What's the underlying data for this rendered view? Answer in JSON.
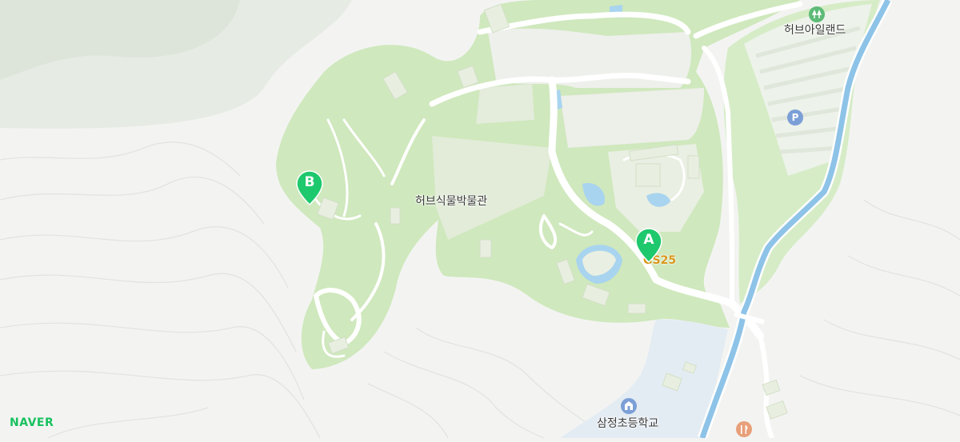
{
  "brand": "NAVER",
  "labels": {
    "museum": "허브식물박물관",
    "herb_island": "허브아일랜드",
    "school": "삼정초등학교"
  },
  "markers": {
    "a": "A",
    "b": "B"
  },
  "store": "GS25",
  "poi": {
    "parking": "P",
    "tree": "tree-icon",
    "school": "school-icon",
    "restaurant": "restaurant-icon"
  },
  "colors": {
    "background": "#f3f4f2",
    "park": "#cfe8bd",
    "water": "#8ec3e8",
    "marker": "#1ec86c",
    "brand": "#19c15f",
    "store": "#d9961a"
  }
}
